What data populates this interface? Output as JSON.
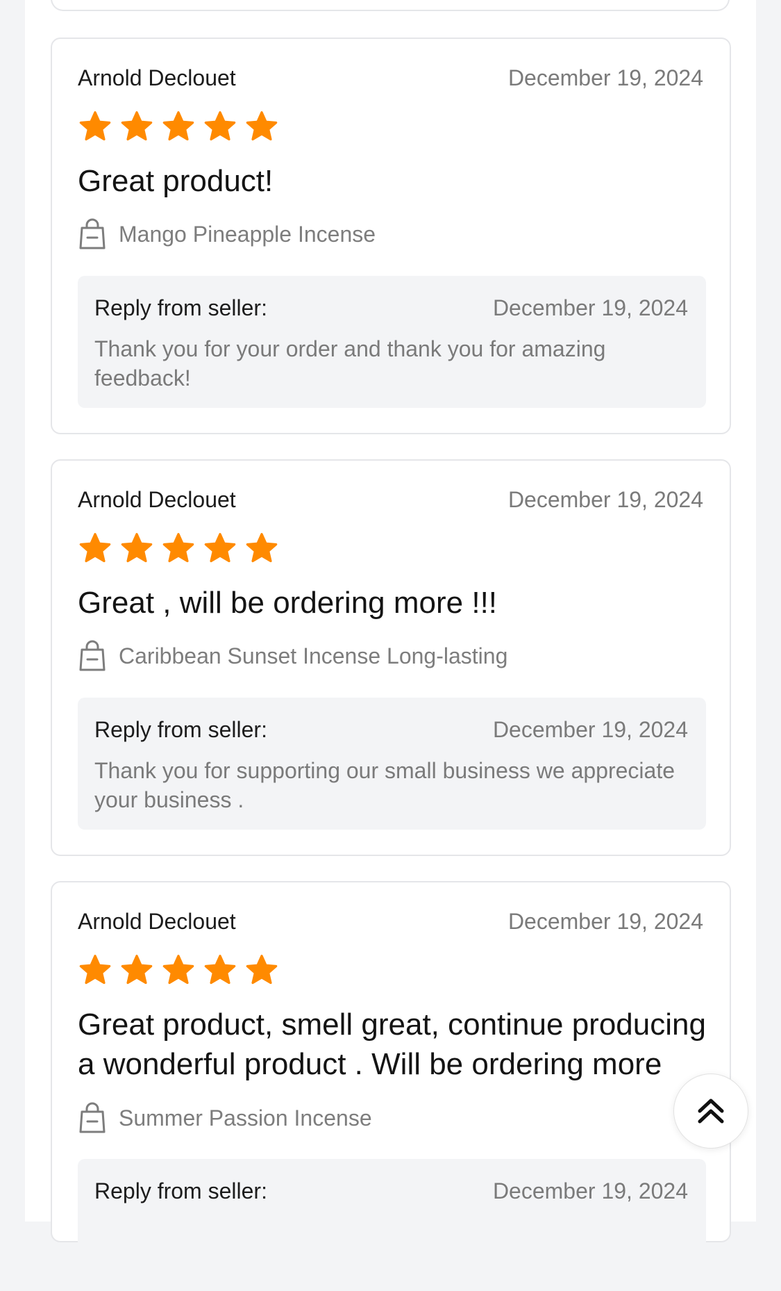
{
  "reviews": [
    {
      "author": "Arnold Declouet",
      "date": "December 19, 2024",
      "rating": 5,
      "title": "Great product!",
      "product": "Mango Pineapple Incense",
      "reply": {
        "label": "Reply from seller:",
        "date": "December 19, 2024",
        "text": "Thank you for your order and thank you for amazing feedback!"
      }
    },
    {
      "author": "Arnold Declouet",
      "date": "December 19, 2024",
      "rating": 5,
      "title": "Great , will be ordering more !!!",
      "product": "Caribbean Sunset Incense Long-lasting",
      "reply": {
        "label": "Reply from seller:",
        "date": "December 19, 2024",
        "text": "Thank you for supporting our small business we appreciate your business ."
      }
    },
    {
      "author": "Arnold Declouet",
      "date": "December 19, 2024",
      "rating": 5,
      "title": "Great product, smell great, continue producing a wonderful product . Will be ordering more",
      "product": "Summer Passion Incense",
      "reply": {
        "label": "Reply from seller:",
        "date": "December 19, 2024"
      }
    }
  ],
  "colors": {
    "star": "#ff8a00",
    "page_bg": "#f3f4f6",
    "card_border": "#e5e6e9",
    "muted_text": "#7a7a7a"
  },
  "icons": {
    "star": "star-icon",
    "product": "shopping-bag-icon",
    "scroll_top": "double-chevron-up-icon"
  }
}
